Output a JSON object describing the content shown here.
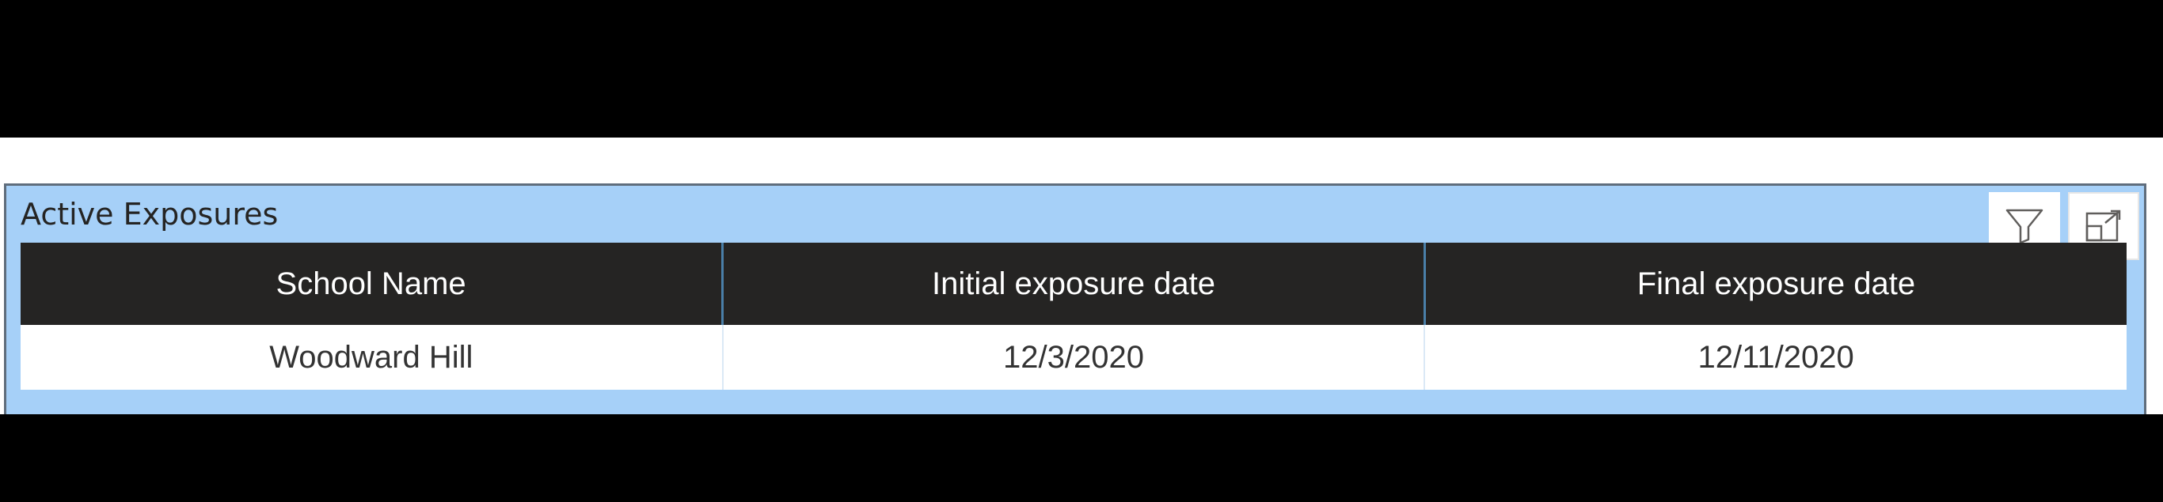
{
  "visual": {
    "title": "Active Exposures",
    "icons": {
      "filter": "filter-icon",
      "focus_mode": "focus-mode-icon"
    }
  },
  "table": {
    "columns": [
      "School Name",
      "Initial exposure date",
      "Final exposure date"
    ],
    "rows": [
      [
        "Woodward Hill",
        "12/3/2020",
        "12/11/2020"
      ]
    ]
  },
  "colors": {
    "visual_background": "#a6d0f8",
    "header_background": "#252423",
    "header_text": "#ffffff",
    "page_letterbox": "#000000"
  }
}
